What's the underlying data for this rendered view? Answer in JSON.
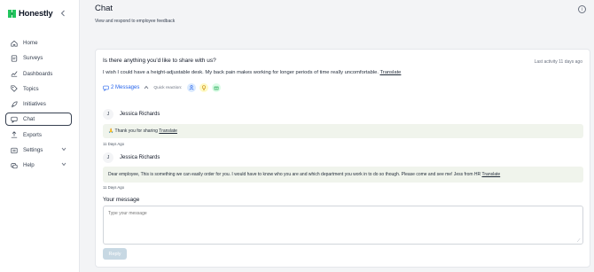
{
  "app": {
    "name": "Honestly"
  },
  "sidebar": {
    "items": [
      {
        "label": "Home",
        "icon": "home-icon"
      },
      {
        "label": "Surveys",
        "icon": "survey-icon"
      },
      {
        "label": "Dashboards",
        "icon": "chart-icon"
      },
      {
        "label": "Topics",
        "icon": "tag-icon"
      },
      {
        "label": "Initiatives",
        "icon": "rocket-icon"
      },
      {
        "label": "Chat",
        "icon": "chat-icon",
        "active": true
      },
      {
        "label": "Exports",
        "icon": "export-icon"
      },
      {
        "label": "Settings",
        "icon": "gear-icon",
        "expandable": true
      },
      {
        "label": "Help",
        "icon": "help-icon",
        "expandable": true
      }
    ]
  },
  "header": {
    "title": "Chat",
    "subtitle": "View and respond to employee feedback"
  },
  "thread": {
    "question": "Is there anything you'd like to share with us?",
    "last_activity": "Last activity 11 days ago",
    "answer": "I wish I could have a height-adjustable desk. My back pain makes working for longer periods of time really uncomfortable.",
    "translate_label": "Translate",
    "messages_count_label": "2 Messages",
    "quick_reaction_label": "Quick reaction:",
    "messages": [
      {
        "author": "Jessica Richards",
        "initial": "J",
        "text": "🙏 Thank you for sharing",
        "translate_label": "Translate",
        "timestamp": "11 Days Ago"
      },
      {
        "author": "Jessica Richards",
        "initial": "J",
        "text": "Dear employee, This is something we can easily order for you. I would have to know who you are and which department you work in to do so though. Please come and see me! Jess from HR",
        "translate_label": "Translate",
        "timestamp": "11 Days Ago"
      }
    ]
  },
  "reply": {
    "label": "Your message",
    "placeholder": "Type your message",
    "button_label": "Reply"
  },
  "colors": {
    "accent": "#2563eb",
    "bubble": "#f0f4ec",
    "reply_button": "#c7d8e3",
    "logo_green": "#22c55e"
  }
}
